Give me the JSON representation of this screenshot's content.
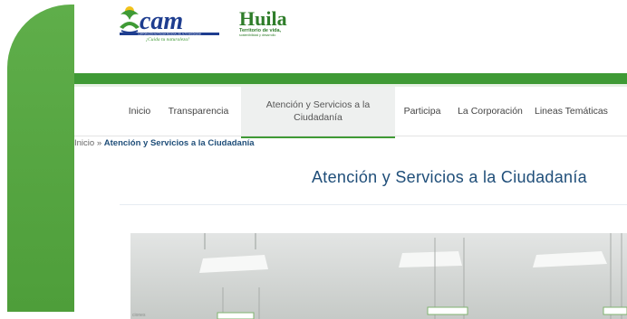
{
  "header": {
    "cam_logo": {
      "text": "cam",
      "subtext": "¡Cuida tu naturaleza!",
      "band_text": "CORPORACIÓN AUTÓNOMA REGIONAL DEL ALTO MAGDALENA",
      "brand_green": "#3f9a35",
      "brand_blue": "#1e3d8f",
      "brand_yellow": "#f2c21b"
    },
    "huila_logo": {
      "text": "Huila",
      "subtext": "Territorio de vida,",
      "subtext2": "sostenibilidad y desarrollo"
    }
  },
  "nav": {
    "items": [
      {
        "label": "Inicio"
      },
      {
        "label": "Transparencia"
      },
      {
        "label": "Atención y Servicios a la Ciudadanía"
      },
      {
        "label": "Participa"
      },
      {
        "label": "La Corporación"
      },
      {
        "label": "Lineas Temáticas"
      }
    ],
    "active": "Atención y Servicios a la Ciudadanía",
    "accent": "#3f9a35"
  },
  "breadcrumb": {
    "home": "Inicio",
    "separator": "»",
    "current": "Atención y Servicios a la Ciudadanía"
  },
  "main": {
    "title": "Atención y Servicios a la Ciudadanía",
    "title_color": "#1f4e79",
    "photo_caption": "ciones"
  }
}
